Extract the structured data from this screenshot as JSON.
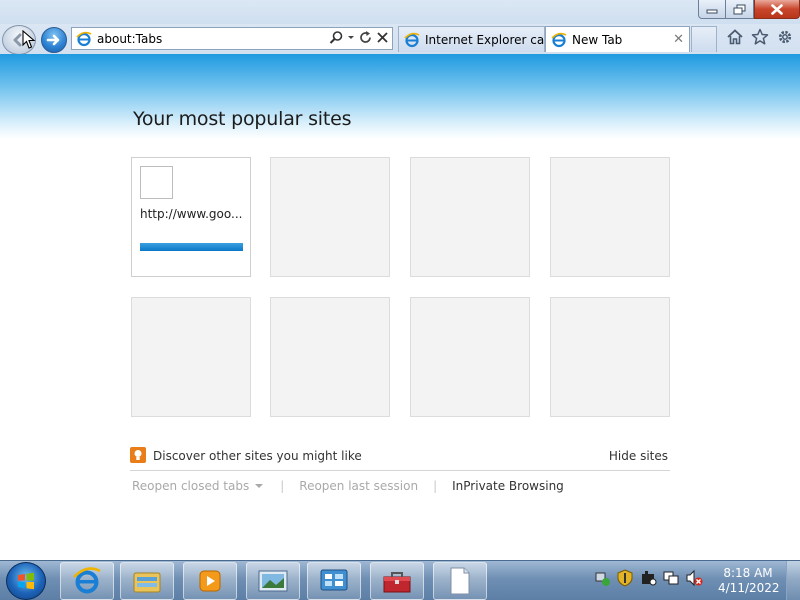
{
  "browser": {
    "address": "about:Tabs",
    "tabs": [
      {
        "label": "Internet Explorer ca...",
        "active": false
      },
      {
        "label": "New Tab",
        "active": true
      }
    ],
    "tab_close_glyph": "✕"
  },
  "newtab_page": {
    "heading": "Your most popular sites",
    "tiles": [
      {
        "url": "http://www.goo..."
      },
      {
        "url": ""
      },
      {
        "url": ""
      },
      {
        "url": ""
      },
      {
        "url": ""
      },
      {
        "url": ""
      },
      {
        "url": ""
      },
      {
        "url": ""
      }
    ],
    "discover_label": "Discover other sites you might like",
    "hide_label": "Hide sites",
    "reopen_closed_tabs": "Reopen closed tabs",
    "reopen_last_session": "Reopen last session",
    "inprivate": "InPrivate Browsing"
  },
  "taskbar": {
    "time": "8:18 AM",
    "date": "4/11/2022",
    "pinned": [
      "internet-explorer",
      "windows-explorer",
      "media-player",
      "photo-viewer",
      "control-panel",
      "toolbox",
      "document"
    ]
  },
  "colors": {
    "accent_blue": "#1f9ae0",
    "close_red": "#c9462c",
    "discover_orange": "#e87d19",
    "tile_bar": "#0b79c7"
  }
}
